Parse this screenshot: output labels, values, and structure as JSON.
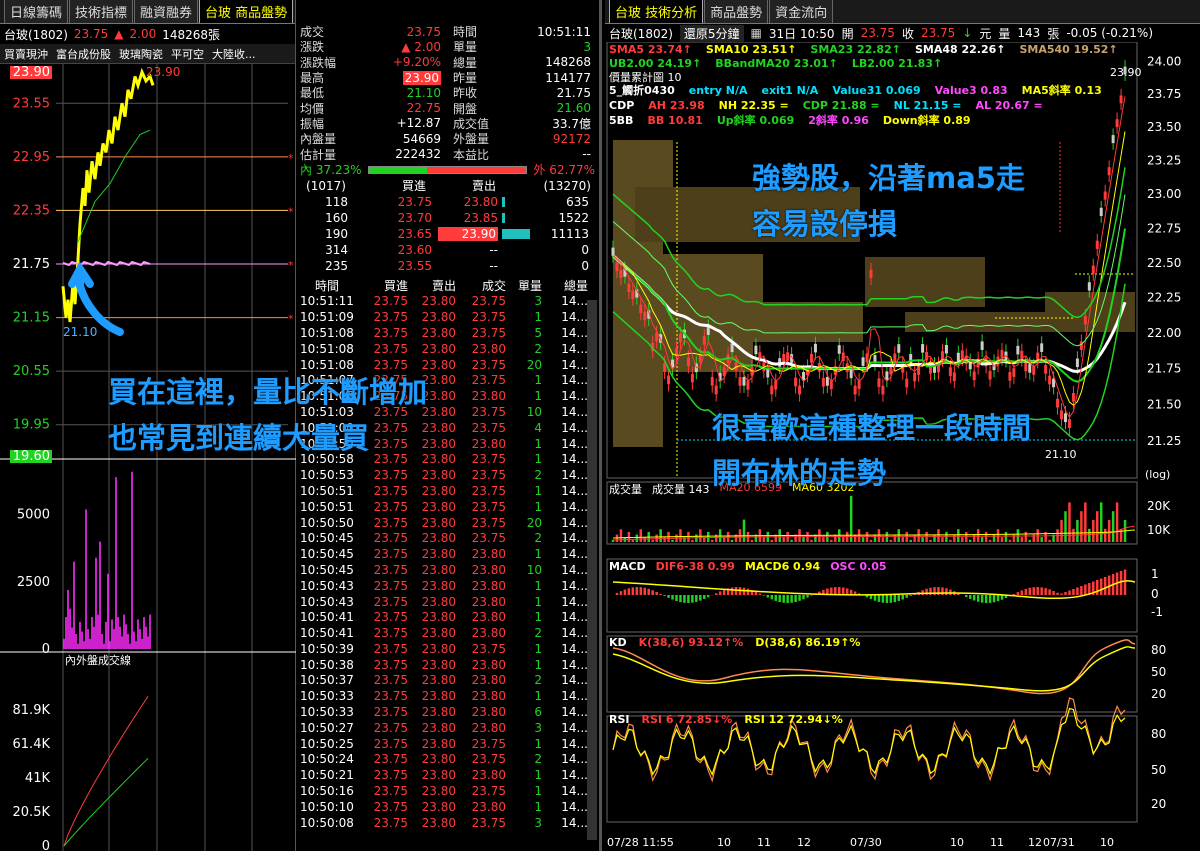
{
  "left": {
    "tabs": [
      "日線籌碼",
      "技術指標",
      "融資融券",
      "台玻 商品盤勢"
    ],
    "symbol": "台玻(1802)",
    "price": "23.75",
    "change_arrow": "▲",
    "change": "2.00",
    "volume": "148268張",
    "toolbar": [
      "買賣現沖",
      "富台成份股",
      "玻璃陶瓷",
      "平可空",
      "大陸收..."
    ],
    "price_axis": [
      "23.90",
      "23.55",
      "22.95",
      "22.35",
      "21.75",
      "21.15",
      "20.55",
      "19.95",
      "19.60"
    ],
    "high_label": "23.90",
    "low_label": "21.10",
    "vol_axis": [
      "5000",
      "2500",
      "0"
    ],
    "vol_title": "內外盤成交線",
    "cum_axis": [
      "81.9K",
      "61.4K",
      "41K",
      "20.5K",
      "0"
    ]
  },
  "mid": {
    "quote": [
      {
        "k1": "成交",
        "v1": "23.75",
        "k2": "時間",
        "v2": "10:51:11"
      },
      {
        "k1": "漲跌",
        "v1": "2.00",
        "k2": "單量",
        "v2": "3"
      },
      {
        "k1": "漲跌幅",
        "v1": "+9.20%",
        "k2": "總量",
        "v2": "148268"
      },
      {
        "k1": "最高",
        "v1": "23.90",
        "k2": "昨量",
        "v2": "114177"
      },
      {
        "k1": "最低",
        "v1": "21.10",
        "k2": "昨收",
        "v2": "21.75"
      },
      {
        "k1": "均價",
        "v1": "22.75",
        "k2": "開盤",
        "v2": "21.60"
      },
      {
        "k1": "振幅",
        "v1": "+12.87",
        "k2": "成交值",
        "v2": "33.7億"
      },
      {
        "k1": "內盤量",
        "v1": "54669",
        "k2": "外盤量",
        "v2": "92172"
      },
      {
        "k1": "估計量",
        "v1": "222432",
        "k2": "本益比",
        "v2": "--"
      }
    ],
    "inner_ratio": "內 37.23%",
    "outer_ratio": "外 62.77%",
    "inner_pct": 37.23,
    "book_head": [
      "(1017)",
      "買進",
      "賣出",
      "(13270)"
    ],
    "book": [
      {
        "bq": "118",
        "bp": "23.75",
        "ap": "23.80",
        "aq": "635"
      },
      {
        "bq": "160",
        "bp": "23.70",
        "ap": "23.85",
        "aq": "1522"
      },
      {
        "bq": "190",
        "bp": "23.65",
        "ap": "23.90",
        "aq": "11113"
      },
      {
        "bq": "314",
        "bp": "23.60",
        "ap": "--",
        "aq": "0"
      },
      {
        "bq": "235",
        "bp": "23.55",
        "ap": "--",
        "aq": "0"
      }
    ],
    "tick_head": [
      "時間",
      "買進",
      "賣出",
      "成交",
      "單量",
      "總量"
    ],
    "ticks": [
      [
        "10:51:11",
        "23.75",
        "23.80",
        "23.75",
        "3",
        "14..."
      ],
      [
        "10:51:09",
        "23.75",
        "23.80",
        "23.75",
        "1",
        "14..."
      ],
      [
        "10:51:08",
        "23.75",
        "23.80",
        "23.75",
        "5",
        "14..."
      ],
      [
        "10:51:08",
        "23.75",
        "23.80",
        "23.80",
        "2",
        "14..."
      ],
      [
        "10:51:08",
        "23.75",
        "23.80",
        "23.75",
        "20",
        "14..."
      ],
      [
        "10:51:07",
        "23.75",
        "23.80",
        "23.75",
        "1",
        "14..."
      ],
      [
        "10:51:07",
        "23.75",
        "23.80",
        "23.80",
        "1",
        "14..."
      ],
      [
        "10:51:03",
        "23.75",
        "23.80",
        "23.75",
        "10",
        "14..."
      ],
      [
        "10:51:00",
        "23.75",
        "23.80",
        "23.75",
        "4",
        "14..."
      ],
      [
        "10:50:59",
        "23.75",
        "23.80",
        "23.80",
        "1",
        "14..."
      ],
      [
        "10:50:58",
        "23.75",
        "23.80",
        "23.75",
        "1",
        "14..."
      ],
      [
        "10:50:53",
        "23.75",
        "23.80",
        "23.75",
        "2",
        "14..."
      ],
      [
        "10:50:51",
        "23.75",
        "23.80",
        "23.75",
        "1",
        "14..."
      ],
      [
        "10:50:51",
        "23.75",
        "23.80",
        "23.75",
        "1",
        "14..."
      ],
      [
        "10:50:50",
        "23.75",
        "23.80",
        "23.75",
        "20",
        "14..."
      ],
      [
        "10:50:45",
        "23.75",
        "23.80",
        "23.75",
        "2",
        "14..."
      ],
      [
        "10:50:45",
        "23.75",
        "23.80",
        "23.80",
        "1",
        "14..."
      ],
      [
        "10:50:45",
        "23.75",
        "23.80",
        "23.80",
        "10",
        "14..."
      ],
      [
        "10:50:43",
        "23.75",
        "23.80",
        "23.80",
        "1",
        "14..."
      ],
      [
        "10:50:43",
        "23.75",
        "23.80",
        "23.80",
        "1",
        "14..."
      ],
      [
        "10:50:41",
        "23.75",
        "23.80",
        "23.80",
        "1",
        "14..."
      ],
      [
        "10:50:41",
        "23.75",
        "23.80",
        "23.80",
        "2",
        "14..."
      ],
      [
        "10:50:39",
        "23.75",
        "23.80",
        "23.75",
        "1",
        "14..."
      ],
      [
        "10:50:38",
        "23.75",
        "23.80",
        "23.80",
        "1",
        "14..."
      ],
      [
        "10:50:37",
        "23.75",
        "23.80",
        "23.80",
        "2",
        "14..."
      ],
      [
        "10:50:33",
        "23.75",
        "23.80",
        "23.80",
        "1",
        "14..."
      ],
      [
        "10:50:33",
        "23.75",
        "23.80",
        "23.80",
        "6",
        "14..."
      ],
      [
        "10:50:27",
        "23.75",
        "23.80",
        "23.80",
        "3",
        "14..."
      ],
      [
        "10:50:25",
        "23.75",
        "23.80",
        "23.75",
        "1",
        "14..."
      ],
      [
        "10:50:24",
        "23.75",
        "23.80",
        "23.75",
        "2",
        "14..."
      ],
      [
        "10:50:21",
        "23.75",
        "23.80",
        "23.80",
        "1",
        "14..."
      ],
      [
        "10:50:16",
        "23.75",
        "23.80",
        "23.75",
        "1",
        "14..."
      ],
      [
        "10:50:10",
        "23.75",
        "23.80",
        "23.80",
        "1",
        "14..."
      ],
      [
        "10:50:08",
        "23.75",
        "23.80",
        "23.75",
        "3",
        "14..."
      ]
    ]
  },
  "right": {
    "tabs": [
      "台玻 技術分析",
      "商品盤勢",
      "資金流向"
    ],
    "header": {
      "symbol": "台玻(1802)",
      "period": "還原5分鐘",
      "date": "31日 10:50",
      "open_label": "開",
      "open": "23.75",
      "close_label": "收",
      "close": "23.75",
      "unit": "元",
      "qty_label": "量",
      "qty": "143",
      "qty_unit": "張",
      "change": "-0.05 (-0.21%)"
    },
    "ind1": [
      {
        "t": "SMA5 23.74↑",
        "c": "#ff3b3b"
      },
      {
        "t": "SMA10 23.51↑",
        "c": "#ff0"
      },
      {
        "t": "SMA23 22.82↑",
        "c": "#21d321"
      },
      {
        "t": "SMA48 22.26↑",
        "c": "#fff"
      },
      {
        "t": "SMA540 19.52↑",
        "c": "#c8a26a"
      }
    ],
    "ind2": [
      {
        "t": "UB2.00 24.19↑",
        "c": "#21d321"
      },
      {
        "t": "BBandMA20 23.01↑",
        "c": "#21d321"
      },
      {
        "t": "LB2.00 21.83↑",
        "c": "#21d321"
      }
    ],
    "ind3": "價量累計圖 10",
    "ind4": [
      {
        "t": "5_觸折0430",
        "c": "#fff"
      },
      {
        "t": "entry N/A",
        "c": "#00e0ff"
      },
      {
        "t": "exit1 N/A",
        "c": "#00e0ff"
      },
      {
        "t": "Value31 0.069",
        "c": "#00e0ff"
      },
      {
        "t": "Value3 0.83",
        "c": "#ff4aff"
      },
      {
        "t": "MA5斜率 0.13",
        "c": "#ff0"
      }
    ],
    "ind5": [
      {
        "t": "CDP",
        "c": "#fff"
      },
      {
        "t": "AH 23.98",
        "c": "#ff3b3b"
      },
      {
        "t": "NH 22.35 =",
        "c": "#ff0"
      },
      {
        "t": "CDP 21.88 =",
        "c": "#21d321"
      },
      {
        "t": "NL 21.15 =",
        "c": "#00e0ff"
      },
      {
        "t": "AL 20.67 =",
        "c": "#ff4aff"
      }
    ],
    "ind6": [
      {
        "t": "5BB",
        "c": "#fff"
      },
      {
        "t": "BB 10.81",
        "c": "#ff3b3b"
      },
      {
        "t": "Up斜率 0.069",
        "c": "#21d321"
      },
      {
        "t": "2斜率 0.96",
        "c": "#ff4aff"
      },
      {
        "t": "Down斜率 0.89",
        "c": "#ff0"
      }
    ],
    "price_axis": [
      "24.00",
      "23.75",
      "23.50",
      "23.25",
      "23.00",
      "22.75",
      "22.50",
      "22.25",
      "22.00",
      "21.75",
      "21.50",
      "21.25"
    ],
    "top_label": "23.90",
    "low_label": "21.10",
    "log": "(log)",
    "vol_head": [
      {
        "t": "成交量",
        "c": "#fff"
      },
      {
        "t": "成交量 143",
        "c": "#fff"
      },
      {
        "t": "MA20 6599",
        "c": "#ff3b3b"
      },
      {
        "t": "MA60 3202",
        "c": "#ff0"
      }
    ],
    "vol_axis": [
      "20K",
      "10K"
    ],
    "macd_head": [
      {
        "t": "MACD",
        "c": "#fff"
      },
      {
        "t": "DIF6-38 0.99",
        "c": "#ff3b3b"
      },
      {
        "t": "MACD6 0.94",
        "c": "#ff0"
      },
      {
        "t": "OSC 0.05",
        "c": "#ff4aff"
      }
    ],
    "macd_axis": [
      "1",
      "0",
      "-1"
    ],
    "kd_head": [
      {
        "t": "KD",
        "c": "#fff"
      },
      {
        "t": "K(38,6) 93.12↑%",
        "c": "#ff3b3b"
      },
      {
        "t": "D(38,6) 86.19↑%",
        "c": "#ff0"
      }
    ],
    "kd_axis": [
      "80",
      "50",
      "20"
    ],
    "rsi_head": [
      {
        "t": "RSI",
        "c": "#fff"
      },
      {
        "t": "RSI 6 72.85↓%",
        "c": "#ff3b3b"
      },
      {
        "t": "RSI 12 72.94↓%",
        "c": "#ff0"
      }
    ],
    "rsi_axis": [
      "80",
      "50",
      "20"
    ],
    "x_axis": [
      "07/28 11:55",
      "10",
      "11",
      "12",
      "07/30",
      "10",
      "11",
      "12",
      "07/31",
      "10"
    ]
  },
  "annotations": {
    "a1": "強勢股，沿著ma5走",
    "a2": "容易設停損",
    "a3": "買在這裡，量比不斷增加",
    "a4": "也常見到連續大量買",
    "a5": "很喜歡這種整理一段時間",
    "a6": "開布林的走勢"
  }
}
